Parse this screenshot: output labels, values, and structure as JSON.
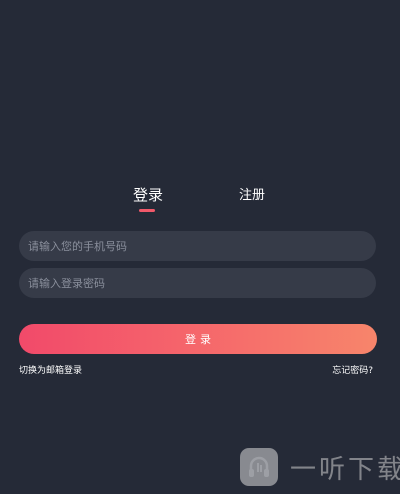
{
  "tabs": {
    "login_label": "登录",
    "register_label": "注册",
    "active": "login"
  },
  "form": {
    "phone_placeholder": "请输入您的手机号码",
    "password_placeholder": "请输入登录密码",
    "submit_label": "登录"
  },
  "links": {
    "email_login": "切换为邮箱登录",
    "forgot_password": "忘记密码?"
  },
  "watermark": {
    "text": "一听下载",
    "logo_icon": "headphone-logo-icon"
  },
  "colors": {
    "background": "#252a37",
    "field": "#363b48",
    "accent_start": "#f14a6a",
    "accent_end": "#f7856b",
    "tab_underline": "#f1596a"
  }
}
